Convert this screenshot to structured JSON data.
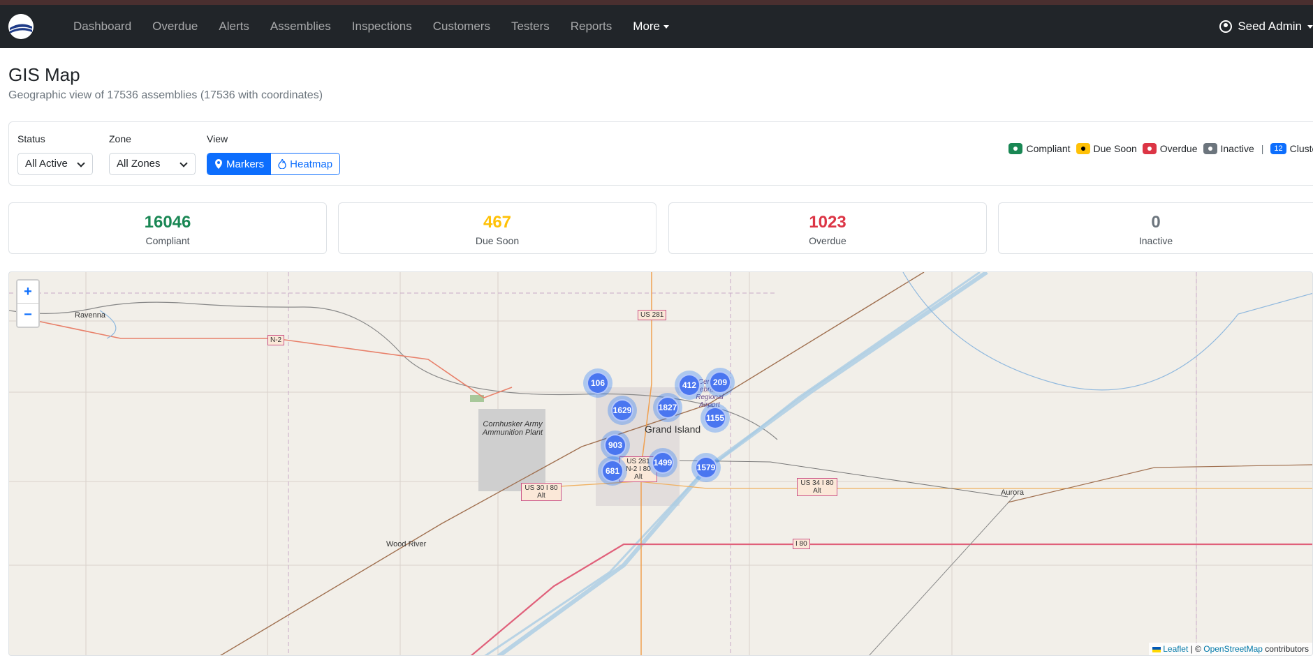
{
  "nav": {
    "items": [
      "Dashboard",
      "Overdue",
      "Alerts",
      "Assemblies",
      "Inspections",
      "Customers",
      "Testers",
      "Reports"
    ],
    "more_label": "More",
    "user_label": "Seed Admin"
  },
  "page": {
    "title": "GIS Map",
    "subtitle": "Geographic view of 17536 assemblies (17536 with coordinates)"
  },
  "filters": {
    "status_label": "Status",
    "status_value": "All Active",
    "zone_label": "Zone",
    "zone_value": "All Zones",
    "view_label": "View",
    "markers_label": "Markers",
    "heatmap_label": "Heatmap"
  },
  "legend": {
    "compliant": "Compliant",
    "due_soon": "Due Soon",
    "overdue": "Overdue",
    "inactive": "Inactive",
    "separator": "|",
    "cluster_count": "12",
    "cluster": "Cluster"
  },
  "stats": [
    {
      "value": "16046",
      "label": "Compliant",
      "color": "#198754"
    },
    {
      "value": "467",
      "label": "Due Soon",
      "color": "#ffc107"
    },
    {
      "value": "1023",
      "label": "Overdue",
      "color": "#dc3545"
    },
    {
      "value": "0",
      "label": "Inactive",
      "color": "#6c757d"
    }
  ],
  "map": {
    "zoom_in": "+",
    "zoom_out": "−",
    "clusters": [
      "106",
      "412",
      "209",
      "1629",
      "1827",
      "1155",
      "903",
      "1499",
      "1579",
      "681"
    ],
    "places": [
      "Ravenna",
      "Grand Island",
      "Aurora",
      "Wood River",
      "Cornhusker Army Ammunition Plant",
      "Central Nebraska Regional Airport"
    ],
    "roads": [
      "US 281",
      "N-2",
      "US 30 I 80 Alt",
      "US 281 N-2 I 80 Alt",
      "US 34 I 80 Alt",
      "I 80"
    ],
    "attribution_leaflet": "Leaflet",
    "attribution_sep": " | © ",
    "attribution_osm": "OpenStreetMap",
    "attribution_tail": " contributors"
  },
  "colors": {
    "compliant": "#198754",
    "due_soon": "#ffc107",
    "overdue": "#dc3545",
    "inactive": "#6c757d",
    "cluster": "#0d6efd"
  }
}
